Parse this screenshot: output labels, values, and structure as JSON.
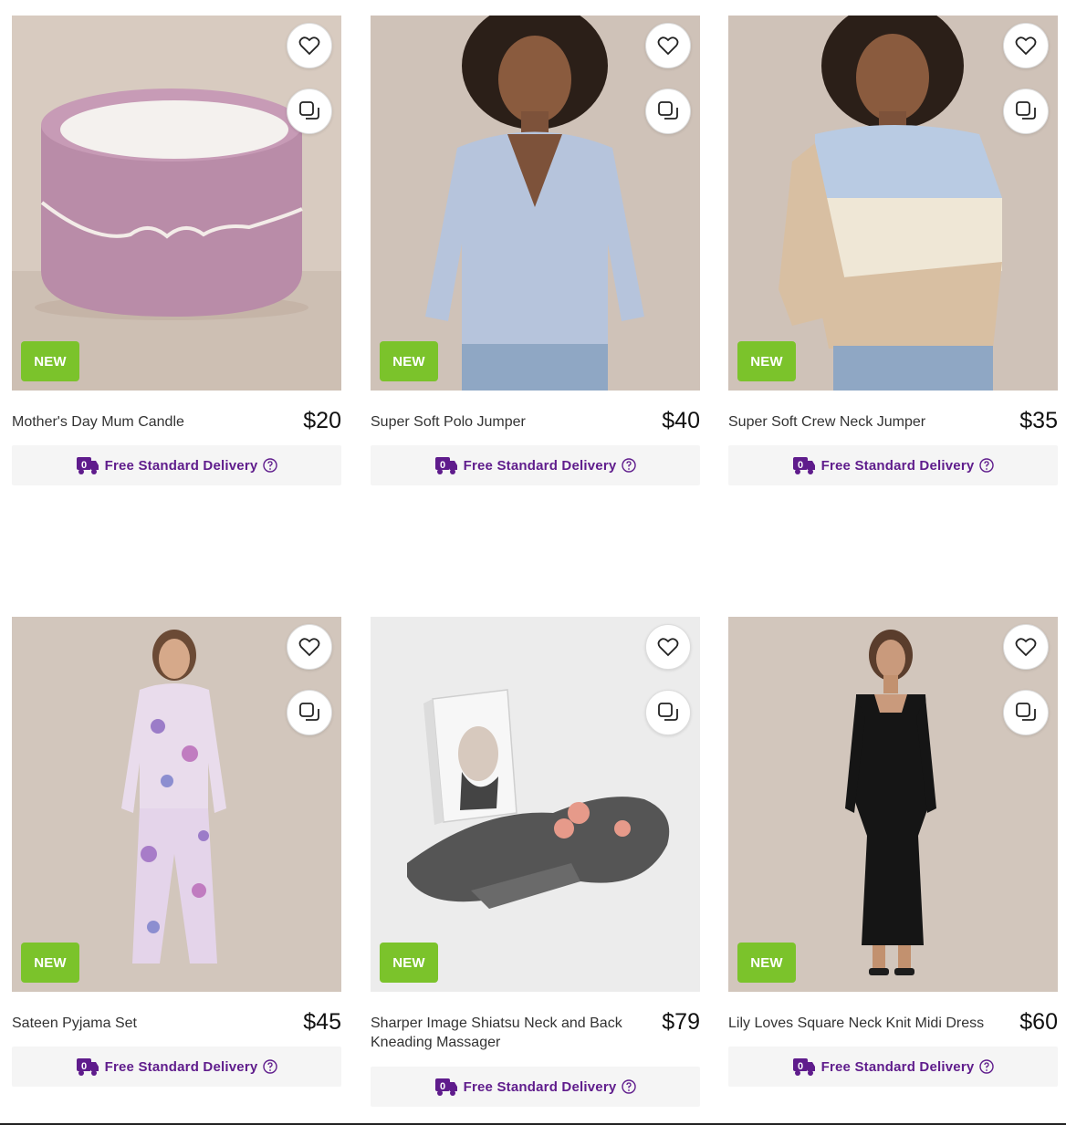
{
  "products": [
    {
      "name": "Mother's Day Mum Candle",
      "price": "$20",
      "badge": "NEW",
      "delivery": "Free Standard Delivery"
    },
    {
      "name": "Super Soft Polo Jumper",
      "price": "$40",
      "badge": "NEW",
      "delivery": "Free Standard Delivery"
    },
    {
      "name": "Super Soft Crew Neck Jumper",
      "price": "$35",
      "badge": "NEW",
      "delivery": "Free Standard Delivery"
    },
    {
      "name": "Sateen Pyjama Set",
      "price": "$45",
      "badge": "NEW",
      "delivery": "Free Standard Delivery"
    },
    {
      "name": "Sharper Image Shiatsu Neck and Back Kneading Massager",
      "price": "$79",
      "badge": "NEW",
      "delivery": "Free Standard Delivery"
    },
    {
      "name": "Lily Loves Square Neck Knit Midi Dress",
      "price": "$60",
      "badge": "NEW",
      "delivery": "Free Standard Delivery"
    }
  ],
  "icons": {
    "wishlist": "heart-icon",
    "compare": "compare-icon",
    "delivery": "delivery-truck-icon",
    "help": "help-circle-icon"
  },
  "colors": {
    "badge": "#7bc32b",
    "delivery_text": "#5f1c8c",
    "delivery_bg": "#f5f5f5"
  }
}
